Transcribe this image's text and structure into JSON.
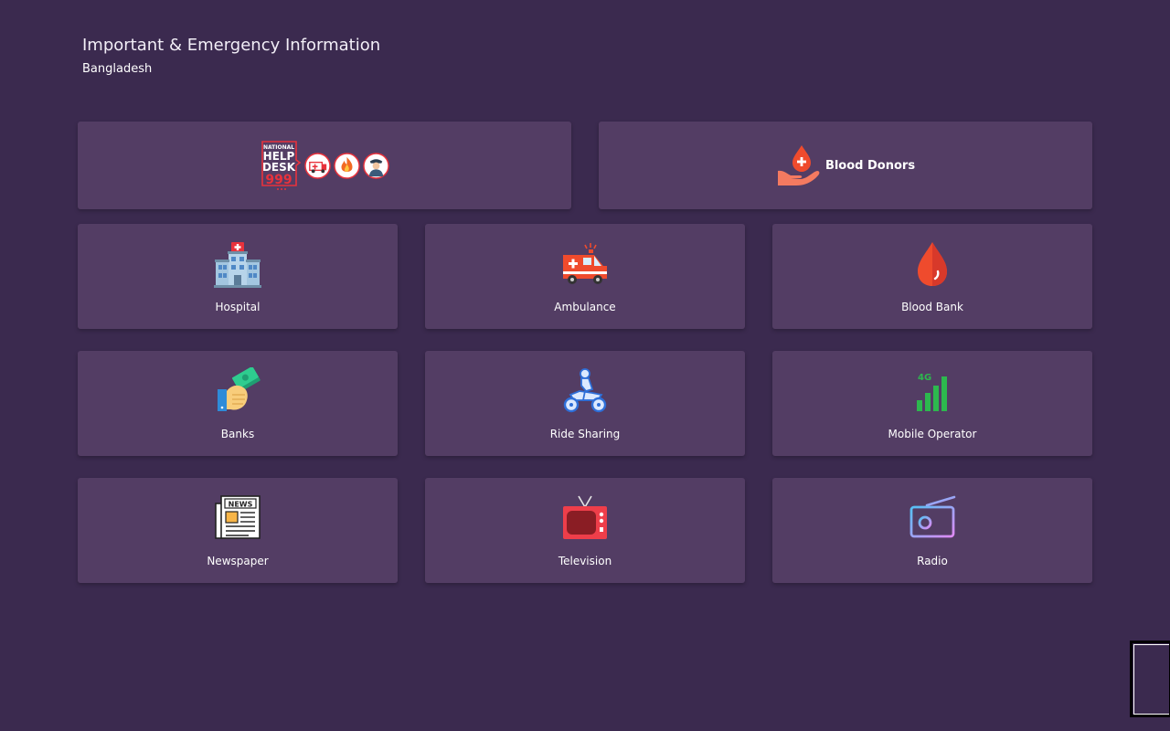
{
  "header": {
    "title": "Important & Emergency Information",
    "subtitle": "Bangladesh"
  },
  "banners": {
    "helpdesk": {
      "logo_lines": [
        "NATIONAL",
        "HELP",
        "DESK",
        "999"
      ],
      "icons": [
        "ambulance-icon",
        "fire-icon",
        "police-icon"
      ]
    },
    "blood_donors": {
      "label": "Blood Donors"
    }
  },
  "categories": [
    {
      "label": "Hospital",
      "icon": "hospital-icon"
    },
    {
      "label": "Ambulance",
      "icon": "ambulance-icon"
    },
    {
      "label": "Blood Bank",
      "icon": "blood-drop-icon"
    },
    {
      "label": "Banks",
      "icon": "money-hand-icon"
    },
    {
      "label": "Ride Sharing",
      "icon": "motorbike-icon"
    },
    {
      "label": "Mobile Operator",
      "icon": "signal-4g-icon"
    },
    {
      "label": "Newspaper",
      "icon": "newspaper-icon"
    },
    {
      "label": "Television",
      "icon": "television-icon"
    },
    {
      "label": "Radio",
      "icon": "radio-icon"
    }
  ],
  "colors": {
    "background": "#3b2a4f",
    "card": "#533d64",
    "accent_red": "#e8323c",
    "blood_red": "#ef4b2d"
  }
}
